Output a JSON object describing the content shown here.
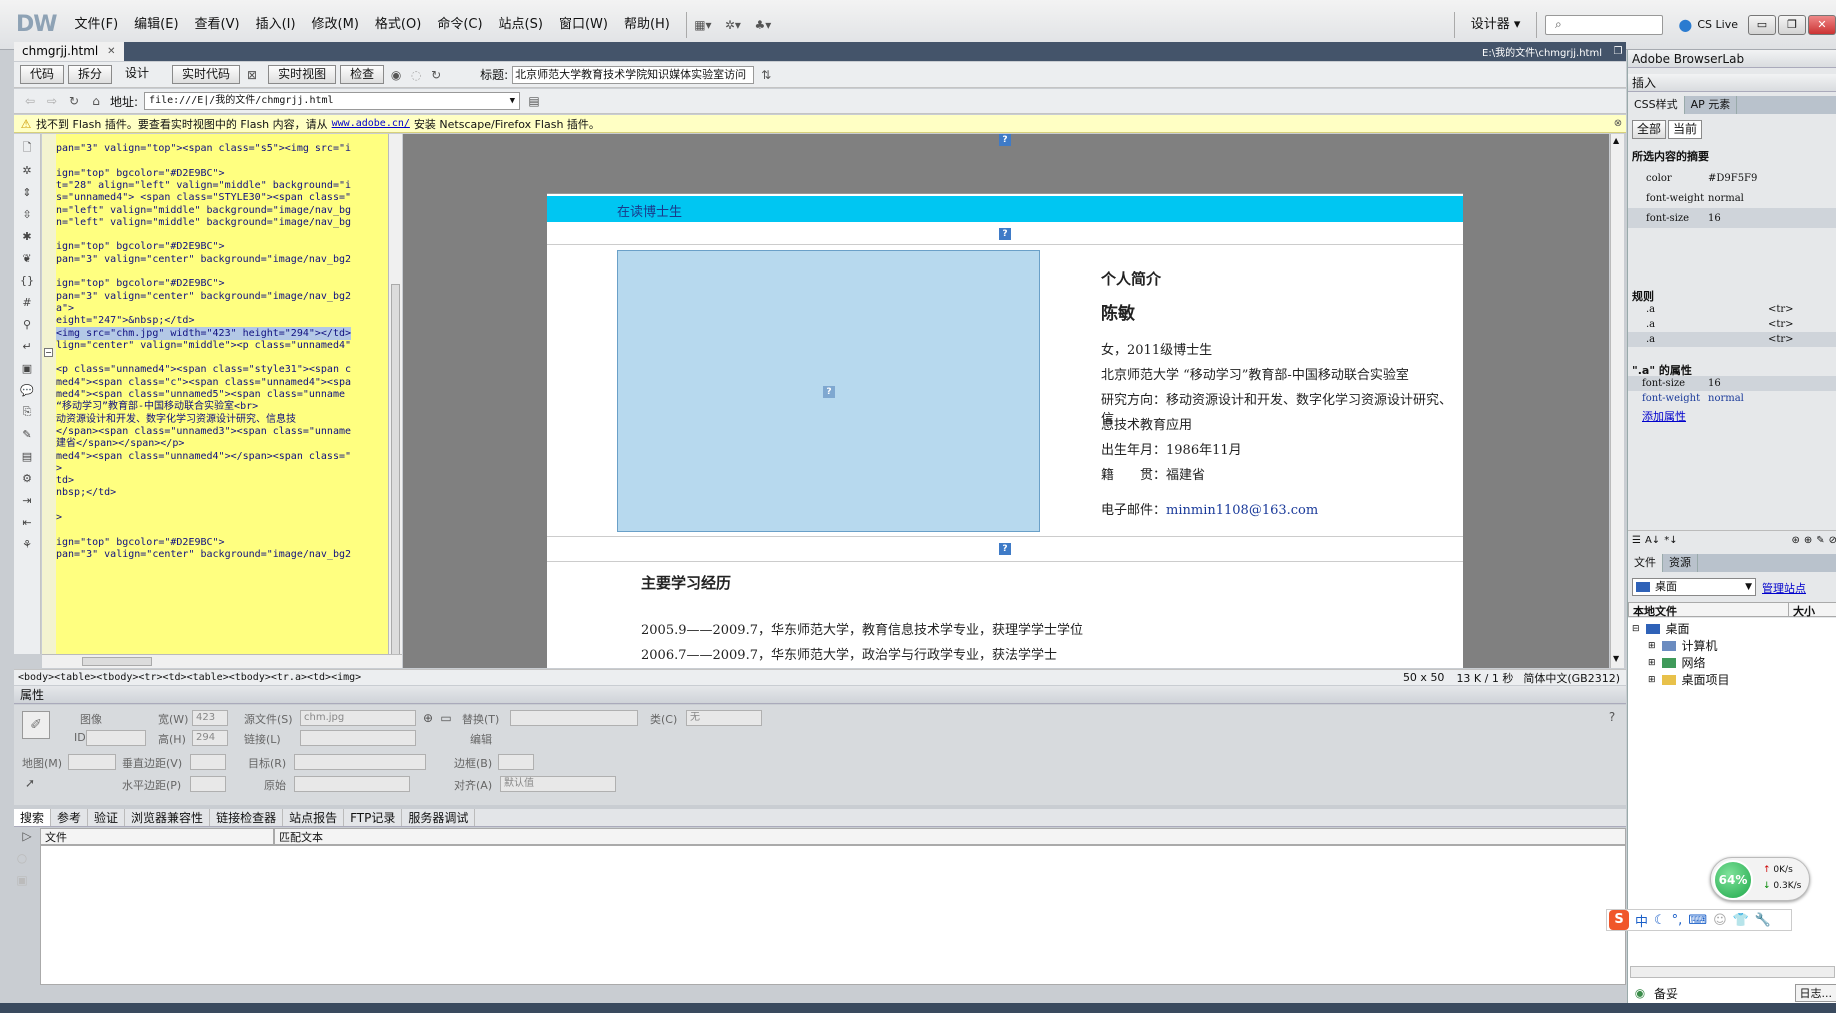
{
  "app": {
    "logo": "DW",
    "menu": [
      "文件(F)",
      "编辑(E)",
      "查看(V)",
      "插入(I)",
      "修改(M)",
      "格式(O)",
      "命令(C)",
      "站点(S)",
      "窗口(W)",
      "帮助(H)"
    ],
    "workspace": "设计器",
    "cs_live": "CS Live",
    "file_path": "E:\\我的文件\\chmgrjj.html"
  },
  "doc_tab": {
    "name": "chmgrjj.html"
  },
  "toolbar": {
    "code": "代码",
    "split": "拆分",
    "design": "设计",
    "live_code": "实时代码",
    "live_view": "实时视图",
    "inspect": "检查",
    "title_label": "标题:",
    "title_value": "北京师范大学教育技术学院知识媒体实验室访问"
  },
  "address": {
    "label": "地址:",
    "value": "file:///E|/我的文件/chmgrjj.html"
  },
  "flash_notice": {
    "before": "找不到 Flash 插件。要查看实时视图中的 Flash 内容，请从",
    "link": "www.adobe.cn/",
    "after": "安装 Netscape/Firefox Flash 插件。"
  },
  "code_lines": [
    "pan=\"3\" valign=\"top\"><span class=\"s5\"><img src=\"i",
    "",
    "ign=\"top\" bgcolor=\"#D2E9BC\">",
    "t=\"28\" align=\"left\" valign=\"middle\" background=\"i",
    "s=\"unnamed4\"> <span class=\"STYLE30\"><span class=\"",
    "n=\"left\" valign=\"middle\" background=\"image/nav_bg",
    "n=\"left\" valign=\"middle\" background=\"image/nav_bg",
    "",
    "ign=\"top\" bgcolor=\"#D2E9BC\">",
    "pan=\"3\" valign=\"center\" background=\"image/nav_bg2",
    "",
    "ign=\"top\" bgcolor=\"#D2E9BC\">",
    "pan=\"3\" valign=\"center\" background=\"image/nav_bg2",
    "a\">",
    "eight=\"247\">&nbsp;</td>",
    "<img src=\"chm.jpg\" width=\"423\" height=\"294\"></td>",
    "lign=\"center\" valign=\"middle\"><p class=\"unnamed4\"",
    "",
    "<p class=\"unnamed4\"><span class=\"style31\"><span c",
    "med4\"><span class=\"c\"><span class=\"unnamed4\"><spa",
    "med4\"><span class=\"unnamed5\"><span class=\"unname",
    "“移动学习”教育部-中国移动联合实验室<br>",
    "动资源设计和开发、数字化学习资源设计研究、信息技",
    "</span><span class=\"unnamed3\"><span class=\"unname",
    "建省</span></span></p>",
    "med4\"><span class=\"unnamed4\"></span><span class=\"",
    ">",
    "td>",
    "nbsp;</td>",
    "",
    ">",
    "",
    "ign=\"top\" bgcolor=\"#D2E9BC\">",
    "pan=\"3\" valign=\"center\" background=\"image/nav_bg2"
  ],
  "design": {
    "banner": "在读博士生",
    "profile": {
      "heading": "个人简介",
      "name": "陈敏",
      "line1": "女，2011级博士生",
      "line2": "北京师范大学 “移动学习”教育部-中国移动联合实验室",
      "line3": "研究方向：移动资源设计和开发、数字化学习资源设计研究、信",
      "line4": "息技术教育应用",
      "line5": "出生年月：1986年11月",
      "line6": "籍　　贯：福建省",
      "email_label": "电子邮件：",
      "email": "minmin1108@163.com"
    },
    "study": {
      "heading": "主要学习经历",
      "item1": "2005.9——2009.7，华东师范大学，教育信息技术学专业，获理学学士学位",
      "item2": "2006.7——2009.7，华东师范大学，政治学与行政学专业，获法学学士"
    }
  },
  "tag_path": "<body><table><tbody><tr><td><table><tbody><tr.a><td><img>",
  "status": {
    "size": "50 x 50",
    "file": "13 K / 1 秒",
    "encoding": "简体中文(GB2312)"
  },
  "properties": {
    "title": "属性",
    "type": "图像",
    "width_label": "宽(W)",
    "width": "423",
    "height_label": "高(H)",
    "height": "294",
    "src_label": "源文件(S)",
    "src": "chm.jpg",
    "link_label": "链接(L)",
    "alt_label": "替换(T)",
    "class_label": "类(C)",
    "class_value": "无",
    "edit_label": "编辑",
    "id_label": "ID",
    "map_label": "地图(M)",
    "vspace_label": "垂直边距(V)",
    "hspace_label": "水平边距(P)",
    "target_label": "目标(R)",
    "lowsrc_label": "原始",
    "border_label": "边框(B)",
    "align_label": "对齐(A)",
    "align_value": "默认值"
  },
  "results": {
    "tabs": [
      "搜索",
      "参考",
      "验证",
      "浏览器兼容性",
      "链接检查器",
      "站点报告",
      "FTP记录",
      "服务器调试"
    ],
    "col_file": "文件",
    "col_match": "匹配文本"
  },
  "right": {
    "browserlab": "Adobe BrowserLab",
    "insert": "插入",
    "css_tab": "CSS样式",
    "ap_tab": "AP 元素",
    "all": "全部",
    "current": "当前",
    "summary_title": "所选内容的摘要",
    "summary": [
      {
        "k": "color",
        "v": "#D9F5F9"
      },
      {
        "k": "font-weight",
        "v": "normal"
      },
      {
        "k": "font-size",
        "v": "16"
      }
    ],
    "rules_title": "规则",
    "rules": [
      {
        "k": ".a",
        "v": "<tr>"
      },
      {
        "k": ".a",
        "v": "<tr>"
      },
      {
        "k": ".a",
        "v": "<tr>"
      }
    ],
    "props_title": "\".a\" 的属性",
    "props": [
      {
        "k": "font-size",
        "v": "16"
      },
      {
        "k": "font-weight",
        "v": "normal"
      }
    ],
    "add_prop": "添加属性",
    "files_tab": "文件",
    "assets_tab": "资源",
    "location": "桌面",
    "manage_sites": "管理站点",
    "col_local": "本地文件",
    "col_size": "大小",
    "tree_root": "桌面",
    "tree": [
      "计算机",
      "网络",
      "桌面项目"
    ],
    "status_text": "备妥",
    "log": "日志..."
  },
  "speed": {
    "percent": "64%",
    "up": "0K/s",
    "down": "0.3K/s"
  },
  "ime": {
    "lang": "中"
  }
}
